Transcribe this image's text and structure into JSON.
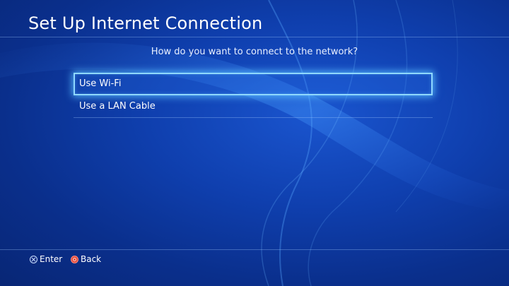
{
  "screen": {
    "title": "Set Up Internet Connection",
    "prompt": "How do you want to connect to the network?"
  },
  "menu": {
    "items": [
      {
        "label": "Use Wi-Fi",
        "selected": true
      },
      {
        "label": "Use a LAN Cable",
        "selected": false
      }
    ]
  },
  "footer": {
    "enter_label": "Enter",
    "back_label": "Back",
    "enter_icon": "cross-button-icon",
    "back_icon": "circle-button-icon"
  },
  "colors": {
    "background": "#0f3fae",
    "highlight": "#8fd8ff",
    "back_icon": "#e44a3a"
  }
}
